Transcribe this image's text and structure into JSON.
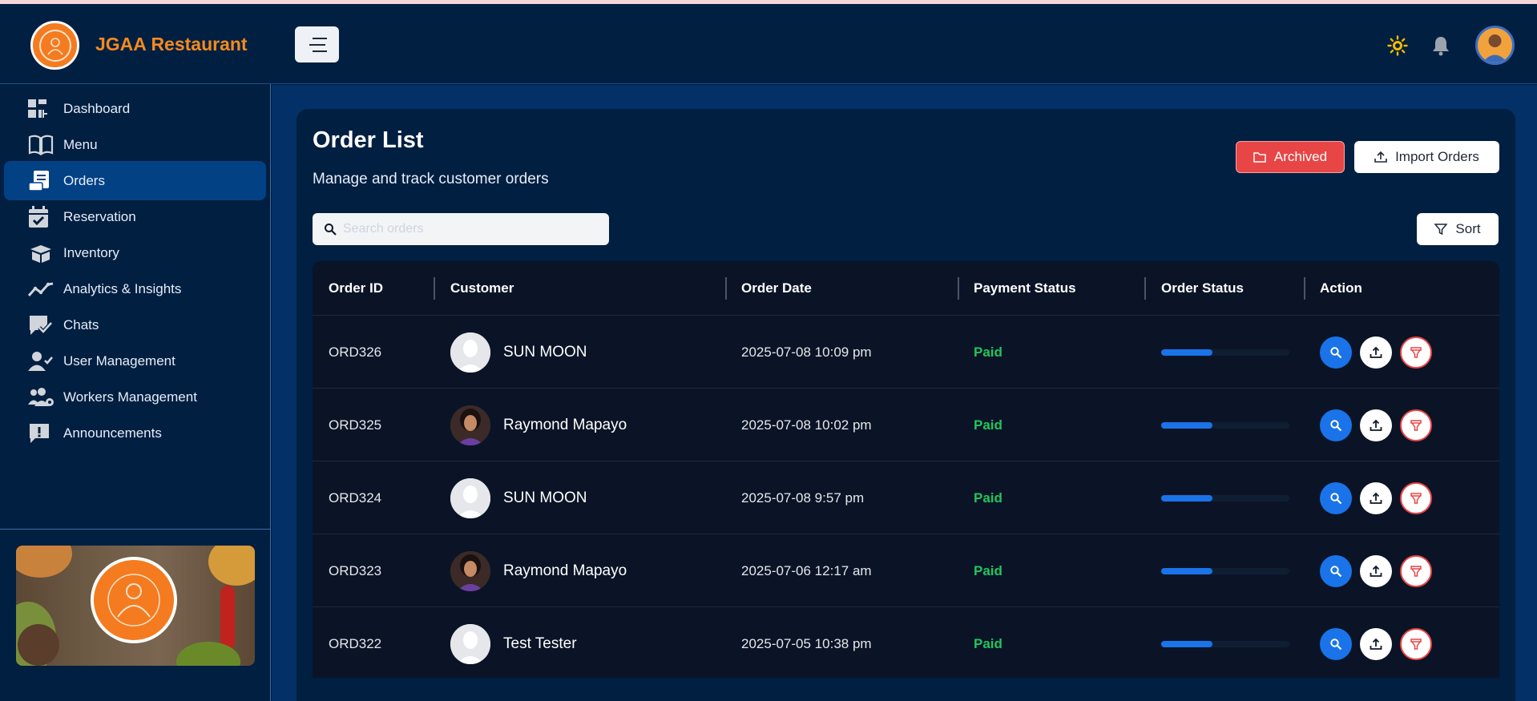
{
  "app": {
    "brand": "JGAA Restaurant",
    "colors": {
      "accent": "#1a73e8",
      "brand": "#f48a1e",
      "danger": "#e84646",
      "success": "#22c55e"
    }
  },
  "header": {
    "menu_toggle_icon": "hamburger-icon",
    "theme_icon": "sun-icon",
    "notification_icon": "bell-icon"
  },
  "sidebar": {
    "items": [
      {
        "label": "Dashboard",
        "icon": "dashboard-icon",
        "active": false
      },
      {
        "label": "Menu",
        "icon": "book-icon",
        "active": false
      },
      {
        "label": "Orders",
        "icon": "receipt-icon",
        "active": true
      },
      {
        "label": "Reservation",
        "icon": "calendar-check-icon",
        "active": false
      },
      {
        "label": "Inventory",
        "icon": "box-icon",
        "active": false
      },
      {
        "label": "Analytics & Insights",
        "icon": "trend-icon",
        "active": false
      },
      {
        "label": "Chats",
        "icon": "chat-check-icon",
        "active": false
      },
      {
        "label": "User Management",
        "icon": "user-check-icon",
        "active": false
      },
      {
        "label": "Workers Management",
        "icon": "users-gear-icon",
        "active": false
      },
      {
        "label": "Announcements",
        "icon": "alert-message-icon",
        "active": false
      }
    ]
  },
  "page": {
    "title": "Order List",
    "subtitle": "Manage and track customer orders",
    "archived_label": "Archived",
    "import_label": "Import Orders",
    "sort_label": "Sort",
    "search_placeholder": "Search orders"
  },
  "table": {
    "columns": [
      "Order ID",
      "Customer",
      "Order Date",
      "Payment Status",
      "Order Status",
      "Action"
    ],
    "rows": [
      {
        "id": "ORD326",
        "customer": "SUN MOON",
        "avatar": "default",
        "date": "2025-07-08 10:09 pm",
        "payment": "Paid",
        "progress": 0.4
      },
      {
        "id": "ORD325",
        "customer": "Raymond Mapayo",
        "avatar": "photo",
        "date": "2025-07-08 10:02 pm",
        "payment": "Paid",
        "progress": 0.4
      },
      {
        "id": "ORD324",
        "customer": "SUN MOON",
        "avatar": "default",
        "date": "2025-07-08 9:57 pm",
        "payment": "Paid",
        "progress": 0.4
      },
      {
        "id": "ORD323",
        "customer": "Raymond Mapayo",
        "avatar": "photo",
        "date": "2025-07-06 12:17 am",
        "payment": "Paid",
        "progress": 0.4
      },
      {
        "id": "ORD322",
        "customer": "Test Tester",
        "avatar": "default",
        "date": "2025-07-05 10:38 pm",
        "payment": "Paid",
        "progress": 0.4
      }
    ]
  }
}
